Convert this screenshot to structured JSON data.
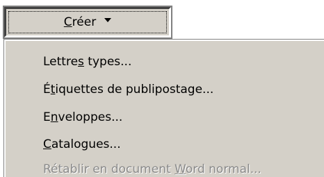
{
  "toolbar": {
    "create_button": {
      "mnemonic": "C",
      "rest": "réer",
      "dropdown_icon": "triangle-down-icon"
    }
  },
  "menu": {
    "items": [
      {
        "pre": "Lettre",
        "mn": "s",
        "post": " types...",
        "enabled": true
      },
      {
        "pre": "É",
        "mn": "t",
        "post": "iquettes de publipostage...",
        "enabled": true
      },
      {
        "pre": "E",
        "mn": "n",
        "post": "veloppes...",
        "enabled": true
      },
      {
        "pre": "",
        "mn": "C",
        "post": "atalogues...",
        "enabled": true
      },
      {
        "pre": "Rétablir en document ",
        "mn": "W",
        "post": "ord normal...",
        "enabled": false
      }
    ]
  }
}
